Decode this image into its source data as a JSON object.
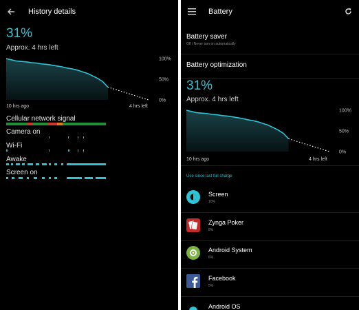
{
  "history": {
    "title": "History details",
    "percent": "31%",
    "approx": "Approx. 4 hrs left",
    "time_start": "10 hrs ago",
    "time_end": "4 hrs left",
    "signals": [
      {
        "label": "Cellular network signal"
      },
      {
        "label": "Camera on"
      },
      {
        "label": "Wi-Fi"
      },
      {
        "label": "Awake"
      },
      {
        "label": "Screen on"
      }
    ]
  },
  "battery": {
    "title": "Battery",
    "saver_title": "Battery saver",
    "saver_sub": "Off / Never turn on automatically",
    "optimization_title": "Battery optimization",
    "percent": "31%",
    "approx": "Approx. 4 hrs left",
    "time_start": "10 hrs ago",
    "time_end": "4 hrs left",
    "use_since": "Use since last full charge",
    "apps": [
      {
        "name": "Screen",
        "pct": "10%",
        "icon": "screen-brightness-icon"
      },
      {
        "name": "Zynga Poker",
        "pct": "8%",
        "icon": "zynga-poker-icon"
      },
      {
        "name": "Android System",
        "pct": "6%",
        "icon": "android-system-icon"
      },
      {
        "name": "Facebook",
        "pct": "5%",
        "icon": "facebook-icon"
      },
      {
        "name": "Android OS",
        "pct": "",
        "icon": "android-os-icon"
      }
    ]
  },
  "colors": {
    "accent": "#2ec4d6",
    "background": "#000000",
    "signal_green": "#1f8f3a",
    "signal_red": "#d0352a",
    "signal_orange": "#e07a1c",
    "facebook_blue": "#3b5998",
    "android_green": "#7cb342",
    "zynga_red": "#c62828"
  },
  "chart_data": [
    {
      "type": "area",
      "title": "",
      "xlabel": "",
      "ylabel": "",
      "y_tick_labels": [
        "100%",
        "50%",
        "0%"
      ],
      "x_tick_labels": [
        "10 hrs ago",
        "4 hrs left"
      ],
      "ylim": [
        0,
        100
      ],
      "xlim": [
        -10,
        4
      ],
      "series": [
        {
          "kind": "measured",
          "x": [
            -10,
            -9.5,
            -9,
            -8.5,
            -8,
            -7.5,
            -7,
            -6.5,
            -6,
            -5.5,
            -5,
            -4.5,
            -4,
            -3.5,
            -3,
            -2.5,
            -2,
            -1.5,
            -1,
            -0.5,
            0
          ],
          "y": [
            100,
            97,
            94,
            93,
            92,
            90,
            89,
            87,
            86,
            84,
            82,
            80,
            77,
            75,
            72,
            68,
            64,
            58,
            52,
            44,
            31
          ]
        },
        {
          "kind": "projected",
          "style": "dotted",
          "x": [
            0,
            4
          ],
          "y": [
            31,
            0
          ]
        }
      ]
    },
    {
      "type": "area",
      "title": "",
      "xlabel": "",
      "ylabel": "",
      "y_tick_labels": [
        "100%",
        "50%",
        "0%"
      ],
      "x_tick_labels": [
        "10 hrs ago",
        "4 hrs left"
      ],
      "ylim": [
        0,
        100
      ],
      "xlim": [
        -10,
        4
      ],
      "series": [
        {
          "kind": "measured",
          "x": [
            -10,
            -9.5,
            -9,
            -8.5,
            -8,
            -7.5,
            -7,
            -6.5,
            -6,
            -5.5,
            -5,
            -4.5,
            -4,
            -3.5,
            -3,
            -2.5,
            -2,
            -1.5,
            -1,
            -0.5,
            0
          ],
          "y": [
            100,
            97,
            94,
            93,
            92,
            90,
            89,
            87,
            86,
            84,
            82,
            80,
            77,
            75,
            72,
            68,
            64,
            58,
            52,
            44,
            31
          ]
        },
        {
          "kind": "projected",
          "style": "dotted",
          "x": [
            0,
            4
          ],
          "y": [
            31,
            0
          ]
        }
      ]
    }
  ]
}
